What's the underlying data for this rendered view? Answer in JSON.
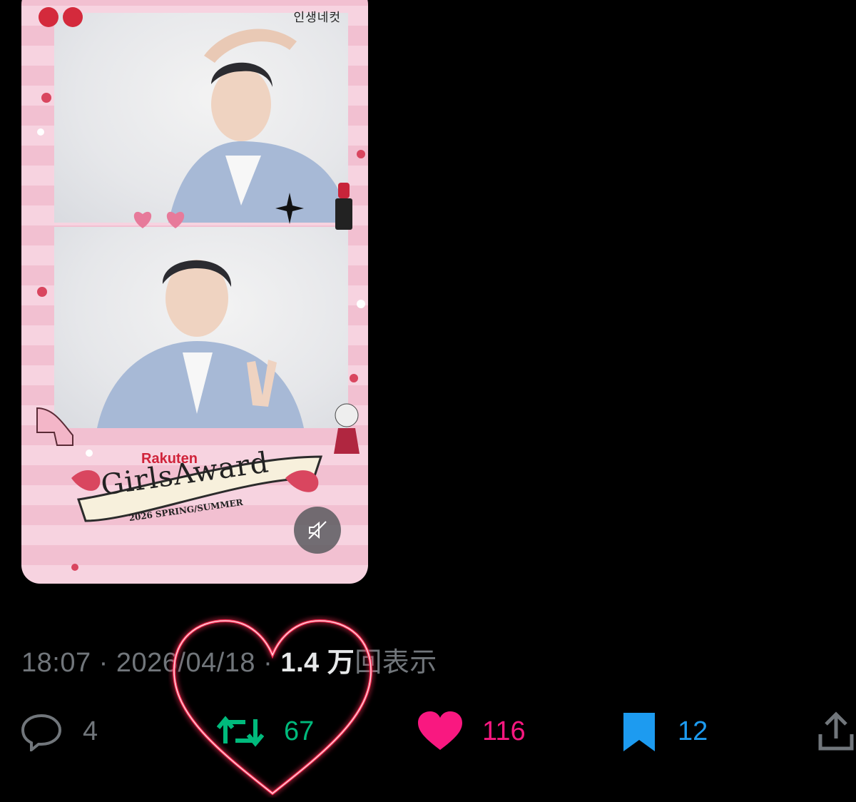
{
  "media": {
    "brand_tag": "인생네컷",
    "sponsor": "Rakuten",
    "award_title": "GirlsAward",
    "award_subtitle": "2026 SPRING/SUMMER",
    "mute_button_icon": "muted-speaker-icon"
  },
  "tweet_meta": {
    "time": "18:07",
    "separator": " · ",
    "date": "2026/04/18",
    "views_count": "1.4 万",
    "views_label": "回表示"
  },
  "actions": {
    "reply": {
      "icon": "reply-bubble-icon",
      "count": "4",
      "color": "#71767b"
    },
    "retweet": {
      "icon": "retweet-icon",
      "count": "67",
      "color": "#00ba7c"
    },
    "like": {
      "icon": "heart-filled-icon",
      "count": "116",
      "color": "#f91880"
    },
    "bookmark": {
      "icon": "bookmark-filled-icon",
      "count": "12",
      "color": "#1d9bf0"
    },
    "share": {
      "icon": "share-upload-icon"
    }
  },
  "overlay": {
    "icon": "neon-heart-outline",
    "color": "#ff2d55"
  }
}
